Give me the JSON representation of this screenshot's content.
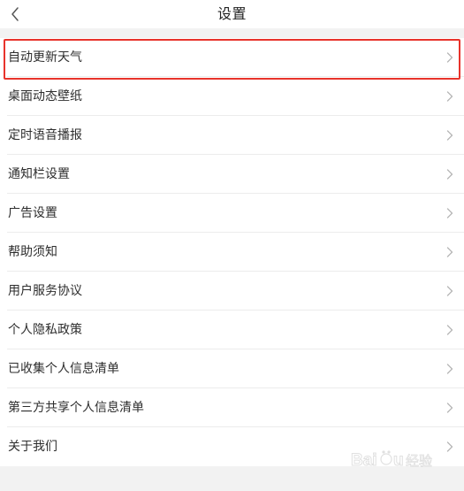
{
  "header": {
    "title": "设置",
    "back_icon": "chevron-left-icon"
  },
  "settings": {
    "items": [
      {
        "label": "自动更新天气",
        "icon": "chevron-right-icon",
        "highlighted": true
      },
      {
        "label": "桌面动态壁纸",
        "icon": "chevron-right-icon"
      },
      {
        "label": "定时语音播报",
        "icon": "chevron-right-icon"
      },
      {
        "label": "通知栏设置",
        "icon": "chevron-right-icon"
      },
      {
        "label": "广告设置",
        "icon": "chevron-right-icon"
      },
      {
        "label": "帮助须知",
        "icon": "chevron-right-icon"
      },
      {
        "label": "用户服务协议",
        "icon": "chevron-right-icon"
      },
      {
        "label": "个人隐私政策",
        "icon": "chevron-right-icon"
      },
      {
        "label": "已收集个人信息清单",
        "icon": "chevron-right-icon"
      },
      {
        "label": "第三方共享个人信息清单",
        "icon": "chevron-right-icon"
      },
      {
        "label": "关于我们",
        "icon": "chevron-right-icon"
      }
    ]
  },
  "annotation": {
    "highlight_color": "#e8332b"
  },
  "watermark": {
    "text": "Baidu经验"
  },
  "colors": {
    "page_background": "#f2f2f2",
    "row_background": "#ffffff",
    "divider": "#ececec",
    "text": "#2e2e2e",
    "chevron": "#b5b5b5"
  }
}
